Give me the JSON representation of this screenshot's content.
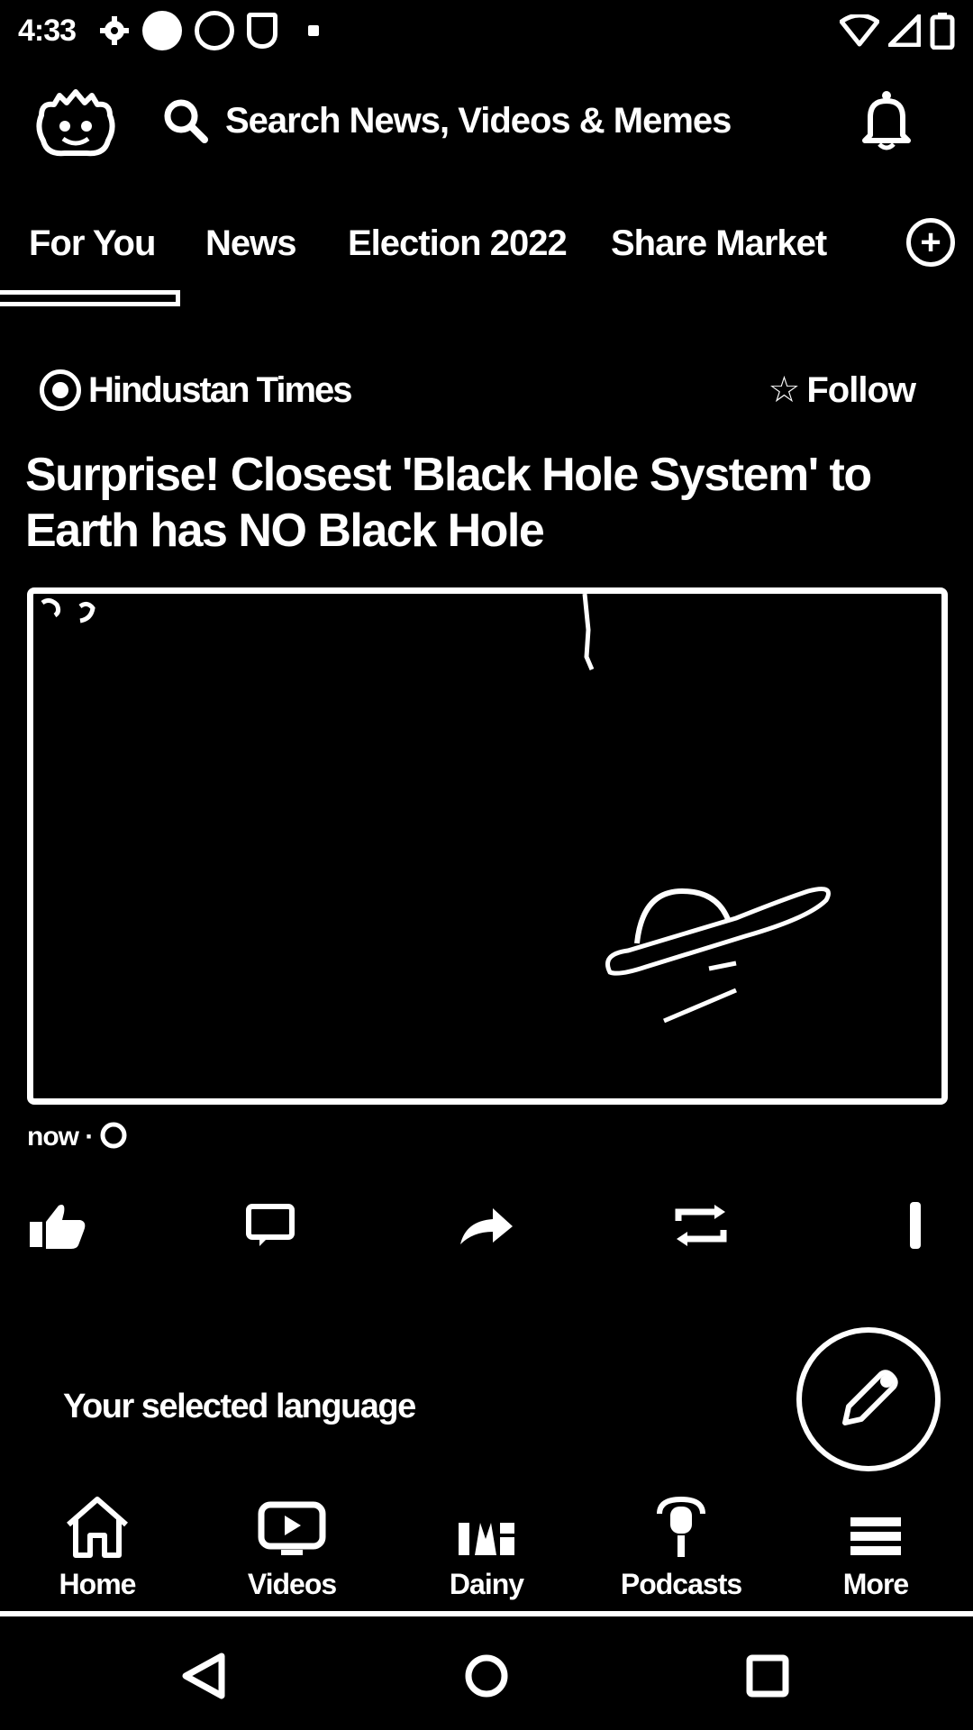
{
  "status_bar": {
    "time": "4:33",
    "left_icons": [
      "gear-icon",
      "notification-icon",
      "notification-icon",
      "shield-icon",
      "dot-icon"
    ],
    "right_icons": [
      "wifi-icon",
      "signal-icon",
      "battery-icon"
    ]
  },
  "header": {
    "logo_icon": "app-logo-icon",
    "search_placeholder": "Search News, Videos & Memes",
    "bell_icon": "bell-icon"
  },
  "tabs": {
    "items": [
      {
        "label": "For You",
        "selected": true
      },
      {
        "label": "News",
        "selected": false
      },
      {
        "label": "Election 2022",
        "selected": false
      },
      {
        "label": "Share Market",
        "selected": false
      }
    ],
    "add_icon": "plus-circle-icon"
  },
  "article": {
    "source_name": "Hindustan Times",
    "follow_label": "Follow",
    "headline": "Surprise! Closest 'Black Hole System' to Earth has NO Black Hole",
    "meta": "now ·",
    "actions": [
      "like-icon",
      "comment-icon",
      "share-icon",
      "repost-icon",
      "more-icon"
    ]
  },
  "language_prompt": "Your selected language",
  "fab_icon": "pencil-icon",
  "bottom_nav": [
    {
      "label": "Home",
      "icon": "home-icon"
    },
    {
      "label": "Videos",
      "icon": "video-icon"
    },
    {
      "label": "Dainy",
      "icon": "dainy-icon"
    },
    {
      "label": "Podcasts",
      "icon": "podcast-icon"
    },
    {
      "label": "More",
      "icon": "menu-icon"
    }
  ],
  "system_nav": [
    "back-icon",
    "home-circle-icon",
    "recents-icon"
  ]
}
